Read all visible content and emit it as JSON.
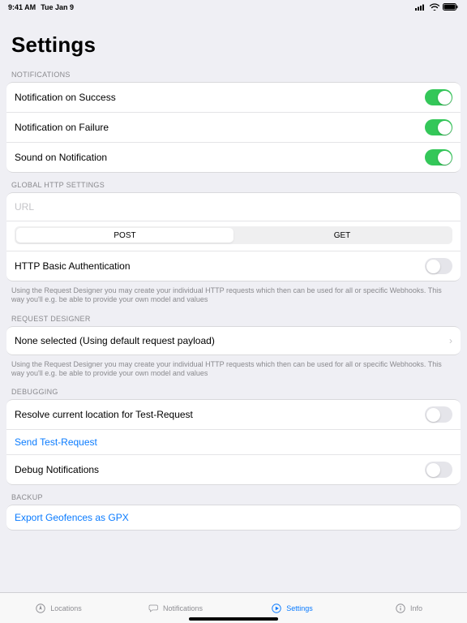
{
  "status": {
    "time": "9:41 AM",
    "date": "Tue Jan 9"
  },
  "page_title": "Settings",
  "sections": {
    "notifications": {
      "header": "NOTIFICATIONS",
      "rows": {
        "success": {
          "label": "Notification on Success",
          "on": true
        },
        "failure": {
          "label": "Notification on Failure",
          "on": true
        },
        "sound": {
          "label": "Sound on Notification",
          "on": true
        }
      }
    },
    "global_http": {
      "header": "GLOBAL HTTP SETTINGS",
      "url_placeholder": "URL",
      "segment": {
        "post": "POST",
        "get": "GET",
        "active": "post"
      },
      "basic_auth": {
        "label": "HTTP Basic Authentication",
        "on": false
      },
      "note": "Using the Request Designer you may create your individual HTTP requests which then can be used for all or specific Webhooks. This way you'll e.g. be able to provide your own model and values"
    },
    "request_designer": {
      "header": "REQUEST DESIGNER",
      "row_label": "None selected (Using default request payload)",
      "note": "Using the Request Designer you may create your individual HTTP requests which then can be used for all or specific Webhooks. This way you'll e.g. be able to provide your own model and values"
    },
    "debugging": {
      "header": "DEBUGGING",
      "resolve": {
        "label": "Resolve current location for Test-Request",
        "on": false
      },
      "send_test": {
        "label": "Send Test-Request"
      },
      "debug_notifs": {
        "label": "Debug Notifications",
        "on": false
      }
    },
    "backup": {
      "header": "BACKUP",
      "export": {
        "label": "Export Geofences as GPX"
      }
    }
  },
  "tabs": {
    "locations": "Locations",
    "notifications": "Notifications",
    "settings": "Settings",
    "info": "Info"
  }
}
